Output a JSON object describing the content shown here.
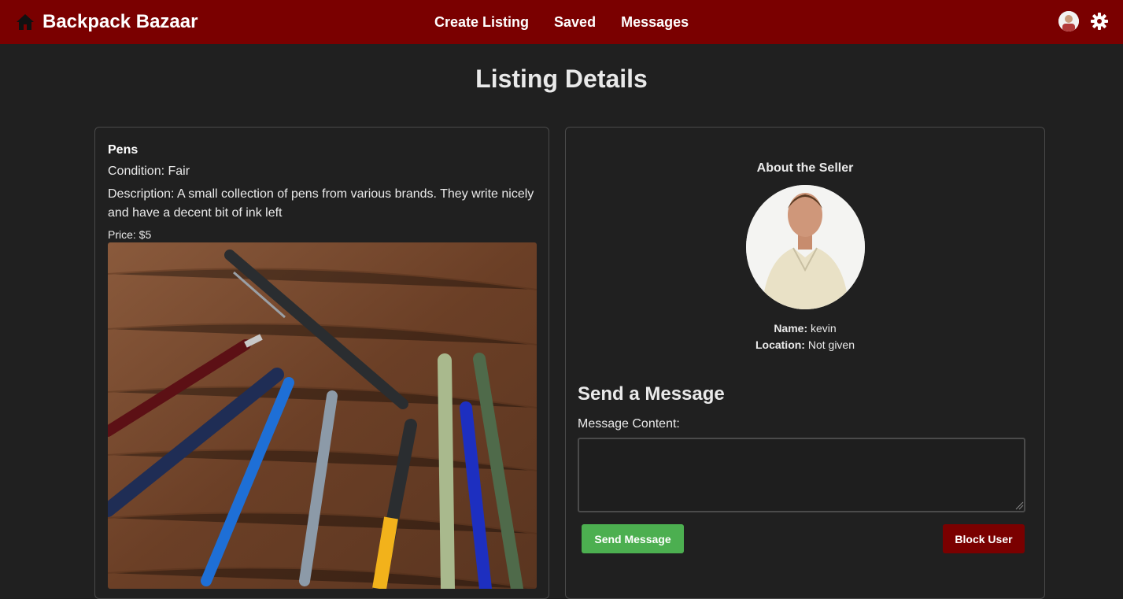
{
  "header": {
    "brand": "Backpack Bazaar",
    "nav": [
      "Create Listing",
      "Saved",
      "Messages"
    ],
    "accent_color": "#7a0000",
    "icons": [
      "home-icon",
      "avatar",
      "gear-icon"
    ]
  },
  "page": {
    "title": "Listing Details"
  },
  "listing": {
    "name": "Pens",
    "condition": "Condition: Fair",
    "description": "Description: A small collection of pens from various brands. They write nicely and have a decent bit of ink left",
    "price": "Price: $5"
  },
  "seller": {
    "heading": "About the Seller",
    "name_label": "Name:",
    "name": "kevin",
    "location_label": "Location:",
    "location": "Not given"
  },
  "message": {
    "heading": "Send a Message",
    "content_label": "Message Content:",
    "content_value": "",
    "send_label": "Send Message",
    "block_label": "Block User",
    "send_color": "#4caf50",
    "block_color": "#7a0000"
  }
}
